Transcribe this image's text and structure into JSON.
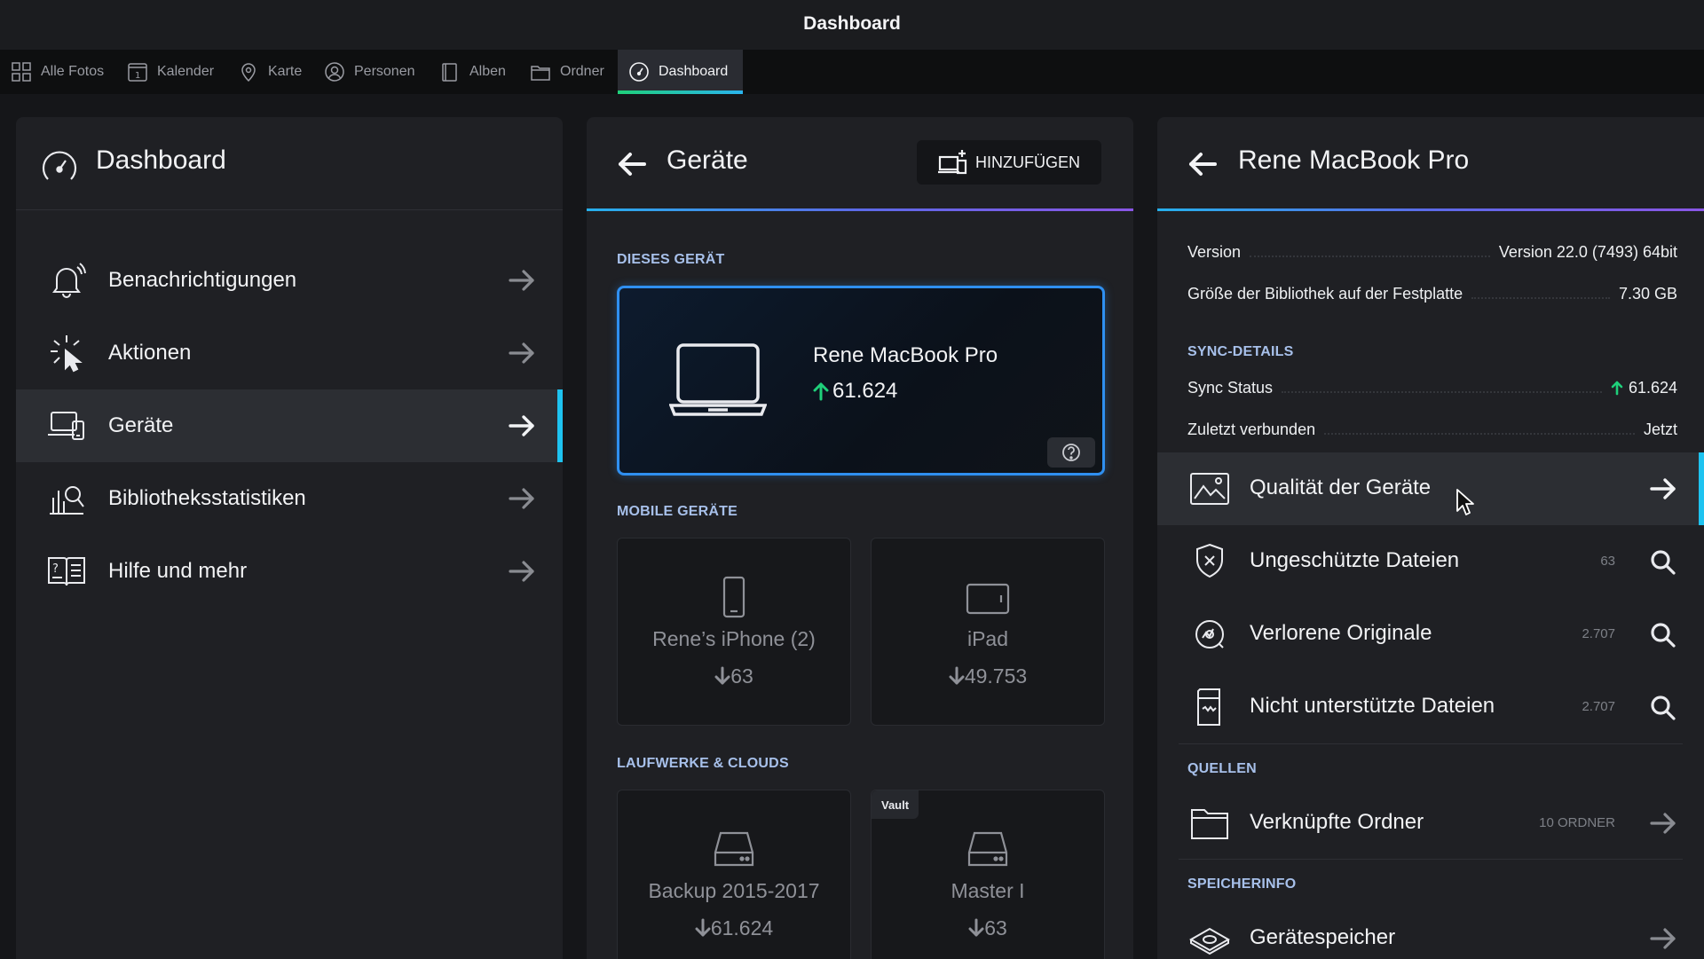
{
  "app": {
    "title": "Dashboard"
  },
  "tabs": [
    {
      "label": "Alle Fotos",
      "icon": "grid-icon"
    },
    {
      "label": "Kalender",
      "icon": "calendar-icon"
    },
    {
      "label": "Karte",
      "icon": "map-pin-icon"
    },
    {
      "label": "Personen",
      "icon": "person-icon"
    },
    {
      "label": "Alben",
      "icon": "album-icon"
    },
    {
      "label": "Ordner",
      "icon": "folder-icon"
    },
    {
      "label": "Dashboard",
      "icon": "gauge-icon",
      "active": true
    }
  ],
  "left": {
    "title": "Dashboard",
    "items": [
      {
        "label": "Benachrichtigungen",
        "icon": "bell-icon"
      },
      {
        "label": "Aktionen",
        "icon": "click-icon"
      },
      {
        "label": "Geräte",
        "icon": "devices-icon",
        "selected": true
      },
      {
        "label": "Bibliotheksstatistiken",
        "icon": "stats-icon"
      },
      {
        "label": "Hilfe und mehr",
        "icon": "help-book-icon"
      }
    ]
  },
  "mid": {
    "title": "Geräte",
    "add_label": "HINZUFÜGEN",
    "this_device_section": "DIESES GERÄT",
    "this_device": {
      "name": "Rene MacBook Pro",
      "count": "61.624"
    },
    "mobile_section": "MOBILE GERÄTE",
    "mobile": [
      {
        "name": "Rene’s iPhone (2)",
        "count": "63"
      },
      {
        "name": "iPad",
        "count": "49.753"
      }
    ],
    "drives_section": "LAUFWERKE & CLOUDS",
    "drives": [
      {
        "name": "Backup 2015-2017",
        "count": "61.624"
      },
      {
        "name": "Master I",
        "count": "63",
        "badge": "Vault"
      }
    ]
  },
  "right": {
    "title": "Rene MacBook Pro",
    "version_label": "Version",
    "version_value": "Version 22.0 (7493) 64bit",
    "size_label": "Größe der Bibliothek auf der Festplatte",
    "size_value": "7.30 GB",
    "sync_section": "SYNC-DETAILS",
    "sync_status_label": "Sync Status",
    "sync_status_value": "61.624",
    "last_connected_label": "Zuletzt verbunden",
    "last_connected_value": "Jetzt",
    "quality_label": "Qualität der Geräte",
    "unprotected_label": "Ungeschützte Dateien",
    "unprotected_count": "63",
    "lost_label": "Verlorene Originale",
    "lost_count": "2.707",
    "unsupported_label": "Nicht unterstützte Dateien",
    "unsupported_count": "2.707",
    "sources_section": "QUELLEN",
    "linked_label": "Verknüpfte Ordner",
    "linked_count": "10 ORDNER",
    "storage_section": "SPEICHERINFO",
    "storage_label": "Gerätespeicher"
  },
  "colors": {
    "accent_blue": "#2f8ff0",
    "selection_bar": "#1ec3f0",
    "sync_green": "#1fd07a",
    "section_label": "#a7c0ea"
  }
}
